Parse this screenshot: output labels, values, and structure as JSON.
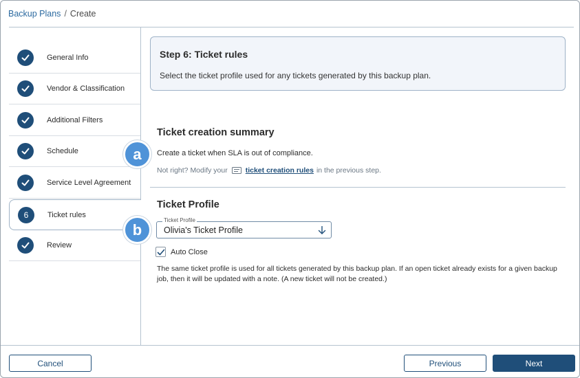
{
  "breadcrumb": {
    "parent": "Backup Plans",
    "separator": "/",
    "current": "Create"
  },
  "sidebar": {
    "steps": [
      {
        "label": "General Info",
        "state": "complete"
      },
      {
        "label": "Vendor & Classification",
        "state": "complete"
      },
      {
        "label": "Additional Filters",
        "state": "complete"
      },
      {
        "label": "Schedule",
        "state": "complete"
      },
      {
        "label": "Service Level Agreement",
        "state": "complete"
      },
      {
        "label": "Ticket rules",
        "state": "active",
        "number": "6"
      },
      {
        "label": "Review",
        "state": "complete"
      }
    ]
  },
  "header": {
    "title": "Step 6: Ticket rules",
    "description": "Select the ticket profile used for any tickets generated by this backup plan."
  },
  "summary": {
    "title": "Ticket creation summary",
    "text": "Create a ticket when SLA is out of compliance.",
    "hint_prefix": "Not right? Modify your",
    "hint_link": "ticket creation rules",
    "hint_suffix": "in the previous step."
  },
  "profile": {
    "title": "Ticket Profile",
    "field_label": "Ticket Profile",
    "field_value": "Olivia's Ticket Profile",
    "auto_close_label": "Auto Close",
    "auto_close_checked": true,
    "explanation": "The same ticket profile is used for all tickets generated by this backup plan. If an open ticket already exists for a given backup job, then it will be updated with a note. (A new ticket will not be created.)"
  },
  "callouts": {
    "a": "a",
    "b": "b"
  },
  "footer": {
    "cancel": "Cancel",
    "previous": "Previous",
    "next": "Next"
  },
  "colors": {
    "accent": "#1f4e79",
    "callout": "#4f93d8",
    "link": "#2c6aa0"
  },
  "icons": {
    "complete_step": "checkmark-icon",
    "select_arrow": "arrow-down-icon",
    "rules_link": "document-icon"
  }
}
